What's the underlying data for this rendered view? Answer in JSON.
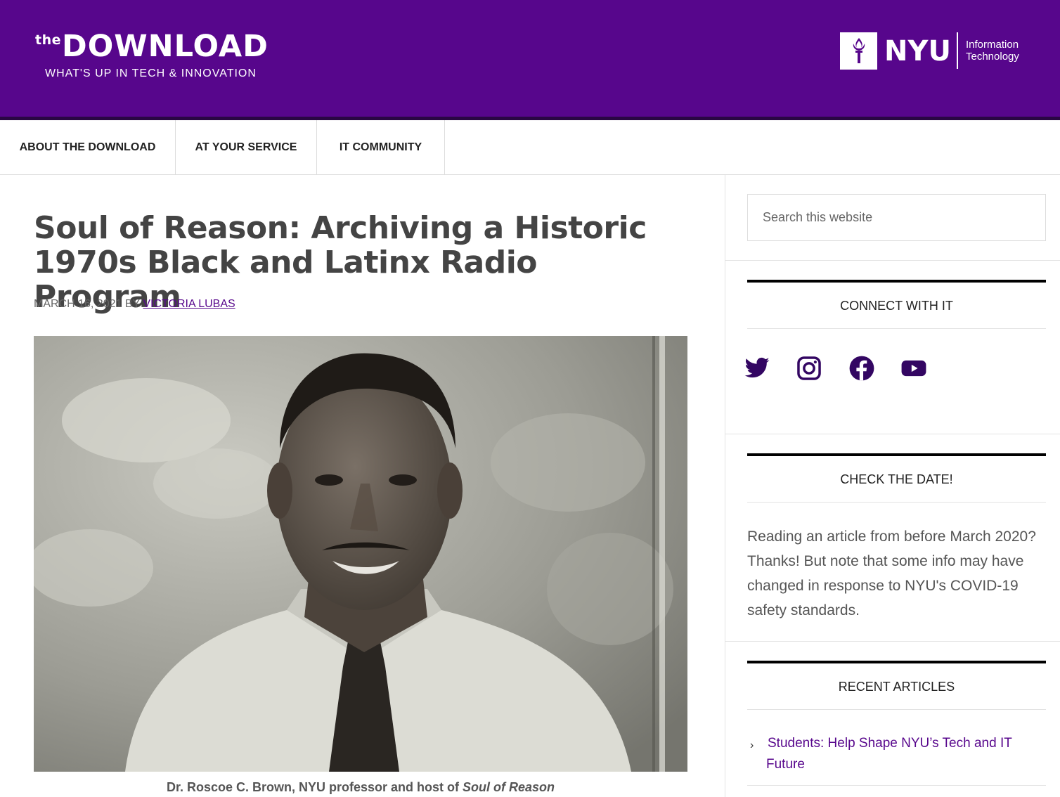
{
  "header": {
    "brand_prefix": "the",
    "brand_name": "DOWNLOAD",
    "brand_tagline": "WHAT'S UP IN TECH & INNOVATION",
    "nyu_wordmark": "NYU",
    "nyu_dept_line1": "Information",
    "nyu_dept_line2": "Technology",
    "brand_color": "#57068c"
  },
  "nav": {
    "items": [
      {
        "label": "ABOUT THE DOWNLOAD"
      },
      {
        "label": "AT YOUR SERVICE"
      },
      {
        "label": "IT COMMUNITY"
      }
    ]
  },
  "article": {
    "title": "Soul of Reason: Archiving a Historic 1970s Black and Latinx Radio Program",
    "date": "MARCH 16, 2021",
    "by": "BY",
    "author": "VICTORIA LUBAS",
    "caption_text": "Dr. Roscoe C. Brown, NYU professor and host of",
    "caption_italic": "Soul of Reason"
  },
  "sidebar": {
    "search_placeholder": "Search this website",
    "connect": {
      "title": "CONNECT WITH IT",
      "icons": [
        "twitter-icon",
        "instagram-icon",
        "facebook-icon",
        "youtube-icon"
      ],
      "icon_color": "#330662"
    },
    "check_date": {
      "title": "CHECK THE DATE!",
      "text": "Reading an article from before March 2020? Thanks! But note that some info may have changed in response to NYU's COVID-19 safety standards."
    },
    "recent": {
      "title": "RECENT ARTICLES",
      "items": [
        {
          "label": "Students: Help Shape NYU’s Tech and IT Future"
        }
      ]
    }
  }
}
